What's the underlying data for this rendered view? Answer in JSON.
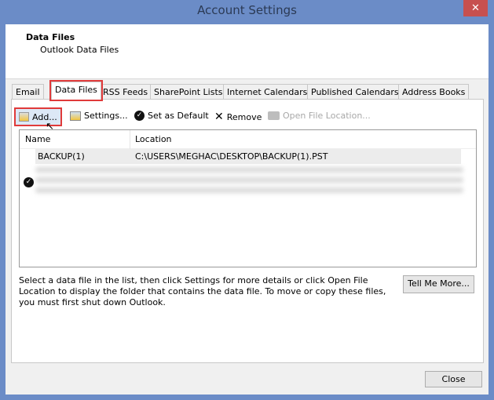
{
  "window": {
    "title": "Account Settings",
    "close_icon": "close-icon"
  },
  "header": {
    "title": "Data Files",
    "subtitle": "Outlook Data Files"
  },
  "tabs": [
    {
      "label": "Email"
    },
    {
      "label": "Data Files",
      "selected": true
    },
    {
      "label": "RSS Feeds"
    },
    {
      "label": "SharePoint Lists"
    },
    {
      "label": "Internet Calendars"
    },
    {
      "label": "Published Calendars"
    },
    {
      "label": "Address Books"
    }
  ],
  "toolbar": {
    "add": "Add...",
    "settings": "Settings...",
    "set_default": "Set as Default",
    "remove": "Remove",
    "open_location": "Open File Location..."
  },
  "list": {
    "columns": [
      "Name",
      "Location"
    ],
    "rows": [
      {
        "name": "BACKUP(1)",
        "location": "C:\\USERS\\MEGHAC\\DESKTOP\\BACKUP(1).PST"
      }
    ]
  },
  "help_text": "Select a data file in the list, then click Settings for more details or click Open File Location to display the folder that contains the data file. To move or copy these files, you must first shut down Outlook.",
  "buttons": {
    "tell_me_more": "Tell Me More...",
    "close": "Close"
  },
  "colors": {
    "title_bar": "#6b8cc7",
    "close": "#c7504f",
    "highlight": "#e03a3a"
  }
}
